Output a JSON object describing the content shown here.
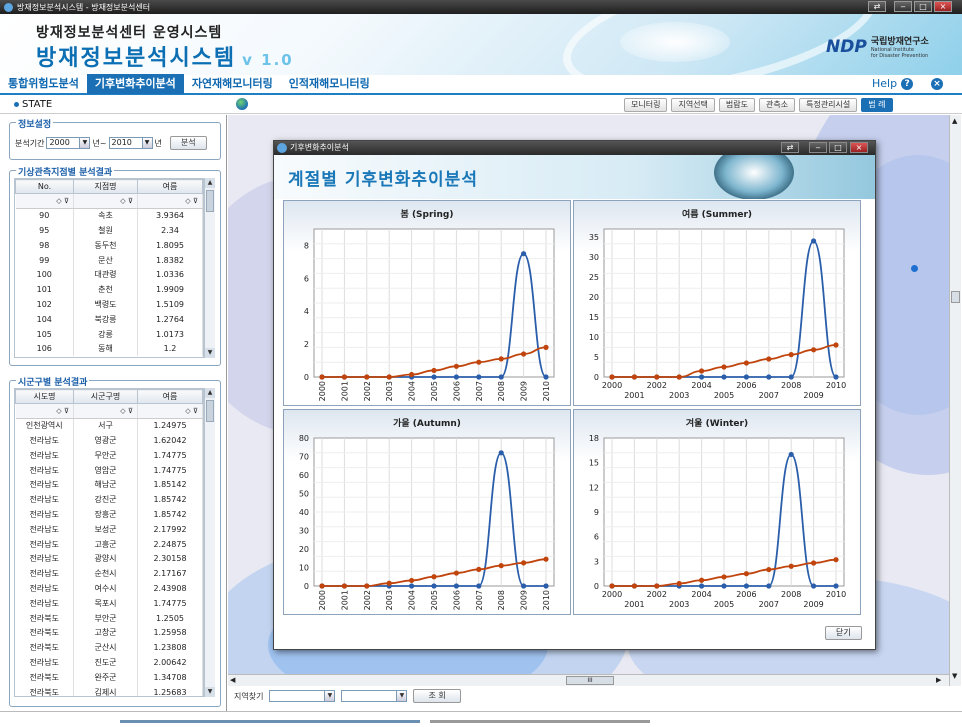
{
  "os": {
    "title": "방재정보분석시스템 - 방재정보분석센터"
  },
  "header": {
    "sub_title": "방재정보분석센터 운영시스템",
    "main_title": "방재정보분석시스템",
    "version": "v 1.0",
    "logo_mark": "NDP",
    "logo_name": "국립방재연구소",
    "logo_eng_1": "National Institute",
    "logo_eng_2": "for Disaster Prevention"
  },
  "nav": {
    "tabs": [
      {
        "label": "통합위험도분석",
        "active": false
      },
      {
        "label": "기후변화추이분석",
        "active": true
      },
      {
        "label": "자연재해모니터링",
        "active": false
      },
      {
        "label": "인적재해모니터링",
        "active": false
      }
    ],
    "help": "Help",
    "help_icon": "?",
    "close_icon": "×"
  },
  "statebar": {
    "state": "STATE",
    "buttons": [
      "모니터링",
      "지역선택",
      "범람도",
      "관측소",
      "특정관리시설",
      "범 례"
    ]
  },
  "info": {
    "title": "정보설정",
    "period_label": "분석기간",
    "from_year": "2000",
    "from_suffix": "년~",
    "to_year": "2010",
    "to_suffix": "년",
    "analyze": "분석"
  },
  "stations": {
    "title": "기상관측지점별 분석결과",
    "headers": [
      "No.",
      "지점명",
      "여름"
    ],
    "rows": [
      [
        "90",
        "속초",
        "3.9364"
      ],
      [
        "95",
        "철원",
        "2.34"
      ],
      [
        "98",
        "동두천",
        "1.8095"
      ],
      [
        "99",
        "문산",
        "1.8382"
      ],
      [
        "100",
        "대관령",
        "1.0336"
      ],
      [
        "101",
        "춘천",
        "1.9909"
      ],
      [
        "102",
        "백령도",
        "1.5109"
      ],
      [
        "104",
        "북강릉",
        "1.2764"
      ],
      [
        "105",
        "강릉",
        "1.0173"
      ],
      [
        "106",
        "동해",
        "1.2"
      ]
    ]
  },
  "districts": {
    "title": "시군구별 분석결과",
    "headers": [
      "시도명",
      "시군구명",
      "여름"
    ],
    "rows": [
      [
        "인천광역시",
        "서구",
        "1.24975"
      ],
      [
        "전라남도",
        "영광군",
        "1.62042"
      ],
      [
        "전라남도",
        "무안군",
        "1.74775"
      ],
      [
        "전라남도",
        "영암군",
        "1.74775"
      ],
      [
        "전라남도",
        "해남군",
        "1.85142"
      ],
      [
        "전라남도",
        "강진군",
        "1.85742"
      ],
      [
        "전라남도",
        "장흥군",
        "1.85742"
      ],
      [
        "전라남도",
        "보성군",
        "2.17992"
      ],
      [
        "전라남도",
        "고흥군",
        "2.24875"
      ],
      [
        "전라남도",
        "광양시",
        "2.30158"
      ],
      [
        "전라남도",
        "순천시",
        "2.17167"
      ],
      [
        "전라남도",
        "여수시",
        "2.43908"
      ],
      [
        "전라남도",
        "목포시",
        "1.74775"
      ],
      [
        "전라북도",
        "부안군",
        "1.2505"
      ],
      [
        "전라북도",
        "고창군",
        "1.25958"
      ],
      [
        "전라북도",
        "군산시",
        "1.23808"
      ],
      [
        "전라남도",
        "진도군",
        "2.00642"
      ],
      [
        "전라북도",
        "완주군",
        "1.34708"
      ],
      [
        "전라북도",
        "김제시",
        "1.25683"
      ]
    ]
  },
  "find": {
    "label": "지역찾기",
    "button": "조 회"
  },
  "map_scroll": {
    "thumb": "III"
  },
  "popup": {
    "window_title": "기후변화추이분석",
    "heading": "계절별 기후변화추이분석",
    "close_button": "닫기"
  },
  "chart_data": [
    {
      "type": "line",
      "title": "봄 (Spring)",
      "x": [
        "2000",
        "2001",
        "2002",
        "2003",
        "2004",
        "2005",
        "2006",
        "2007",
        "2008",
        "2009",
        "2010"
      ],
      "ylim": [
        0,
        9
      ],
      "yticks": [
        0,
        2,
        4,
        6,
        8
      ],
      "xlabel_style": "vertical",
      "series": [
        {
          "color": "#2b5eaa",
          "values": [
            0,
            0,
            0,
            0,
            0,
            0,
            0,
            0,
            0,
            7.5,
            0
          ]
        },
        {
          "color": "#c0440c",
          "values": [
            0,
            0,
            0,
            0,
            0.15,
            0.4,
            0.65,
            0.9,
            1.1,
            1.4,
            1.8
          ]
        }
      ]
    },
    {
      "type": "line",
      "title": "여름 (Summer)",
      "x": [
        "2000",
        "2001",
        "2002",
        "2003",
        "2004",
        "2005",
        "2006",
        "2007",
        "2008",
        "2009",
        "2010"
      ],
      "ylim": [
        0,
        37
      ],
      "yticks": [
        0,
        5,
        10,
        15,
        20,
        25,
        30,
        35
      ],
      "xlabel_style": "staggered",
      "series": [
        {
          "color": "#2b5eaa",
          "values": [
            0,
            0,
            0,
            0,
            0,
            0,
            0,
            0,
            0,
            34,
            0
          ]
        },
        {
          "color": "#c0440c",
          "values": [
            0,
            0,
            0,
            0,
            1.5,
            2.5,
            3.5,
            4.5,
            5.6,
            6.8,
            8
          ]
        }
      ]
    },
    {
      "type": "line",
      "title": "가을 (Autumn)",
      "x": [
        "2000",
        "2001",
        "2002",
        "2003",
        "2004",
        "2005",
        "2006",
        "2007",
        "2008",
        "2009",
        "2010"
      ],
      "ylim": [
        0,
        80
      ],
      "yticks": [
        0,
        10,
        20,
        30,
        40,
        50,
        60,
        70,
        80
      ],
      "xlabel_style": "vertical",
      "series": [
        {
          "color": "#2b5eaa",
          "values": [
            0,
            0,
            0,
            0,
            0,
            0,
            0,
            0,
            72,
            0,
            0
          ]
        },
        {
          "color": "#c0440c",
          "values": [
            0,
            0,
            0,
            1.5,
            3,
            5,
            7,
            9,
            11,
            12.5,
            14.5
          ]
        }
      ]
    },
    {
      "type": "line",
      "title": "겨울 (Winter)",
      "x": [
        "2000",
        "2001",
        "2002",
        "2003",
        "2004",
        "2005",
        "2006",
        "2007",
        "2008",
        "2009",
        "2010"
      ],
      "ylim": [
        0,
        18
      ],
      "yticks": [
        0,
        3,
        6,
        9,
        12,
        15,
        18
      ],
      "xlabel_style": "staggered",
      "series": [
        {
          "color": "#2b5eaa",
          "values": [
            0,
            0,
            0,
            0,
            0,
            0,
            0,
            0,
            16,
            0,
            0
          ]
        },
        {
          "color": "#c0440c",
          "values": [
            0,
            0,
            0,
            0.3,
            0.7,
            1.1,
            1.5,
            2,
            2.4,
            2.8,
            3.2
          ]
        }
      ]
    }
  ]
}
